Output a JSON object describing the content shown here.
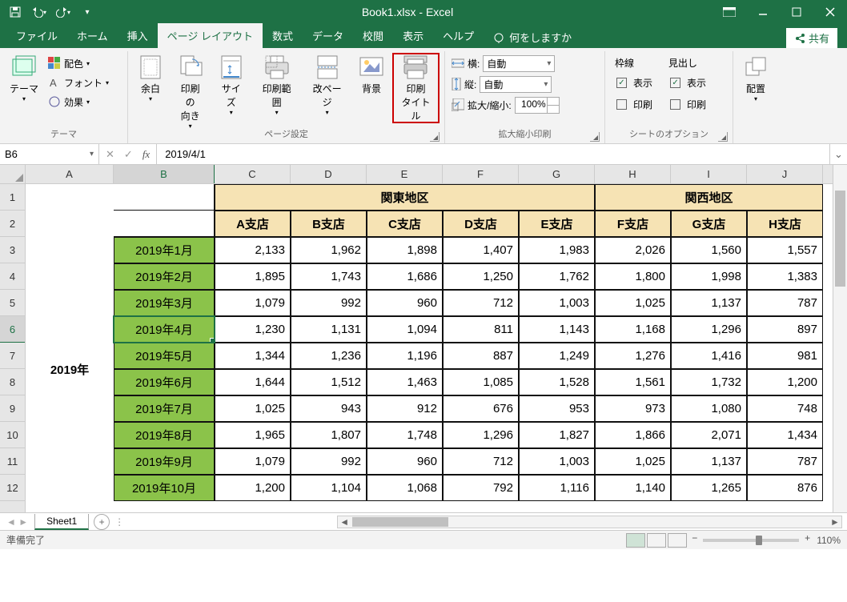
{
  "titlebar": {
    "title": "Book1.xlsx  -  Excel"
  },
  "tabs": {
    "items": [
      "ファイル",
      "ホーム",
      "挿入",
      "ページ レイアウト",
      "数式",
      "データ",
      "校閲",
      "表示",
      "ヘルプ"
    ],
    "tellme": "何をしますか",
    "share": "共有"
  },
  "ribbon": {
    "theme": {
      "label": "テーマ",
      "group": "テーマ",
      "colors": "配色",
      "fonts": "フォント",
      "effects": "効果"
    },
    "page": {
      "group": "ページ設定",
      "margins": "余白",
      "orient": "印刷の\n向き",
      "size": "サイズ",
      "area": "印刷範囲",
      "breaks": "改ページ",
      "bg": "背景",
      "titles": "印刷\nタイトル"
    },
    "scale": {
      "group": "拡大縮小印刷",
      "width": "横:",
      "height": "縦:",
      "scale": "拡大/縮小:",
      "auto": "自動",
      "scale_val": "100%"
    },
    "sheet": {
      "group": "シートのオプション",
      "gridlines": "枠線",
      "headings": "見出し",
      "show": "表示",
      "print": "印刷"
    },
    "arrange": {
      "group": "配置",
      "label": "配置"
    }
  },
  "fbar": {
    "name": "B6",
    "formula": "2019/4/1"
  },
  "grid": {
    "colw": {
      "A": 110,
      "data": 95
    },
    "cols": [
      "A",
      "B",
      "C",
      "D",
      "E",
      "F",
      "G",
      "H",
      "I",
      "J"
    ],
    "rows": [
      "1",
      "2",
      "3",
      "4",
      "5",
      "6",
      "7",
      "8",
      "9",
      "10",
      "11",
      "12"
    ],
    "active": {
      "row": 6,
      "col": "B"
    },
    "region1": "関東地区",
    "region2": "関西地区",
    "branches": [
      "A支店",
      "B支店",
      "C支店",
      "D支店",
      "E支店",
      "F支店",
      "G支店",
      "H支店"
    ],
    "year": "2019年",
    "months": [
      "2019年1月",
      "2019年2月",
      "2019年3月",
      "2019年4月",
      "2019年5月",
      "2019年6月",
      "2019年7月",
      "2019年8月",
      "2019年9月",
      "2019年10月"
    ],
    "values": [
      [
        "2,133",
        "1,962",
        "1,898",
        "1,407",
        "1,983",
        "2,026",
        "1,560",
        "1,557"
      ],
      [
        "1,895",
        "1,743",
        "1,686",
        "1,250",
        "1,762",
        "1,800",
        "1,998",
        "1,383"
      ],
      [
        "1,079",
        "992",
        "960",
        "712",
        "1,003",
        "1,025",
        "1,137",
        "787"
      ],
      [
        "1,230",
        "1,131",
        "1,094",
        "811",
        "1,143",
        "1,168",
        "1,296",
        "897"
      ],
      [
        "1,344",
        "1,236",
        "1,196",
        "887",
        "1,249",
        "1,276",
        "1,416",
        "981"
      ],
      [
        "1,644",
        "1,512",
        "1,463",
        "1,085",
        "1,528",
        "1,561",
        "1,732",
        "1,200"
      ],
      [
        "1,025",
        "943",
        "912",
        "676",
        "953",
        "973",
        "1,080",
        "748"
      ],
      [
        "1,965",
        "1,807",
        "1,748",
        "1,296",
        "1,827",
        "1,866",
        "2,071",
        "1,434"
      ],
      [
        "1,079",
        "992",
        "960",
        "712",
        "1,003",
        "1,025",
        "1,137",
        "787"
      ],
      [
        "1,200",
        "1,104",
        "1,068",
        "792",
        "1,116",
        "1,140",
        "1,265",
        "876"
      ]
    ]
  },
  "sheet": {
    "name": "Sheet1"
  },
  "status": {
    "ready": "準備完了",
    "zoom": "110%"
  }
}
